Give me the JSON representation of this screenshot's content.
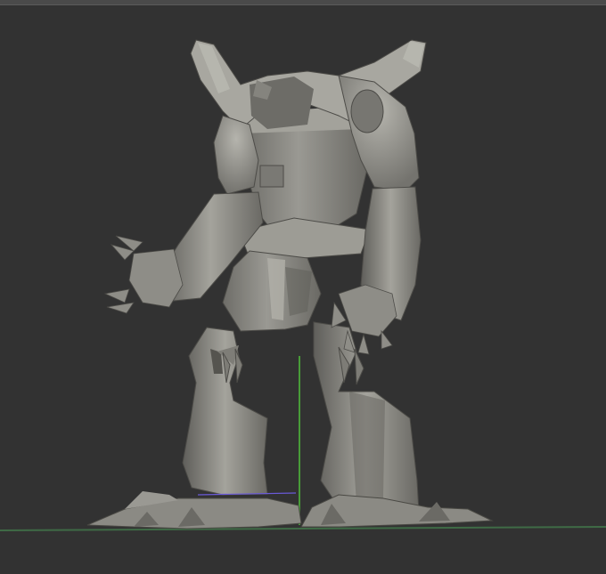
{
  "app": {
    "viewport_label": "",
    "background_color": "#323232",
    "top_edge_color": "#4a4a4a"
  },
  "scene": {
    "model_color": "#8f8e88",
    "model_shadow_color": "#5e5d58",
    "model_highlight_color": "#b8b7b0",
    "axis_colors": {
      "y_axis": "#4fbf3a",
      "x_axis": "#6a5ad8",
      "floor_line": "#3f6b46"
    }
  }
}
